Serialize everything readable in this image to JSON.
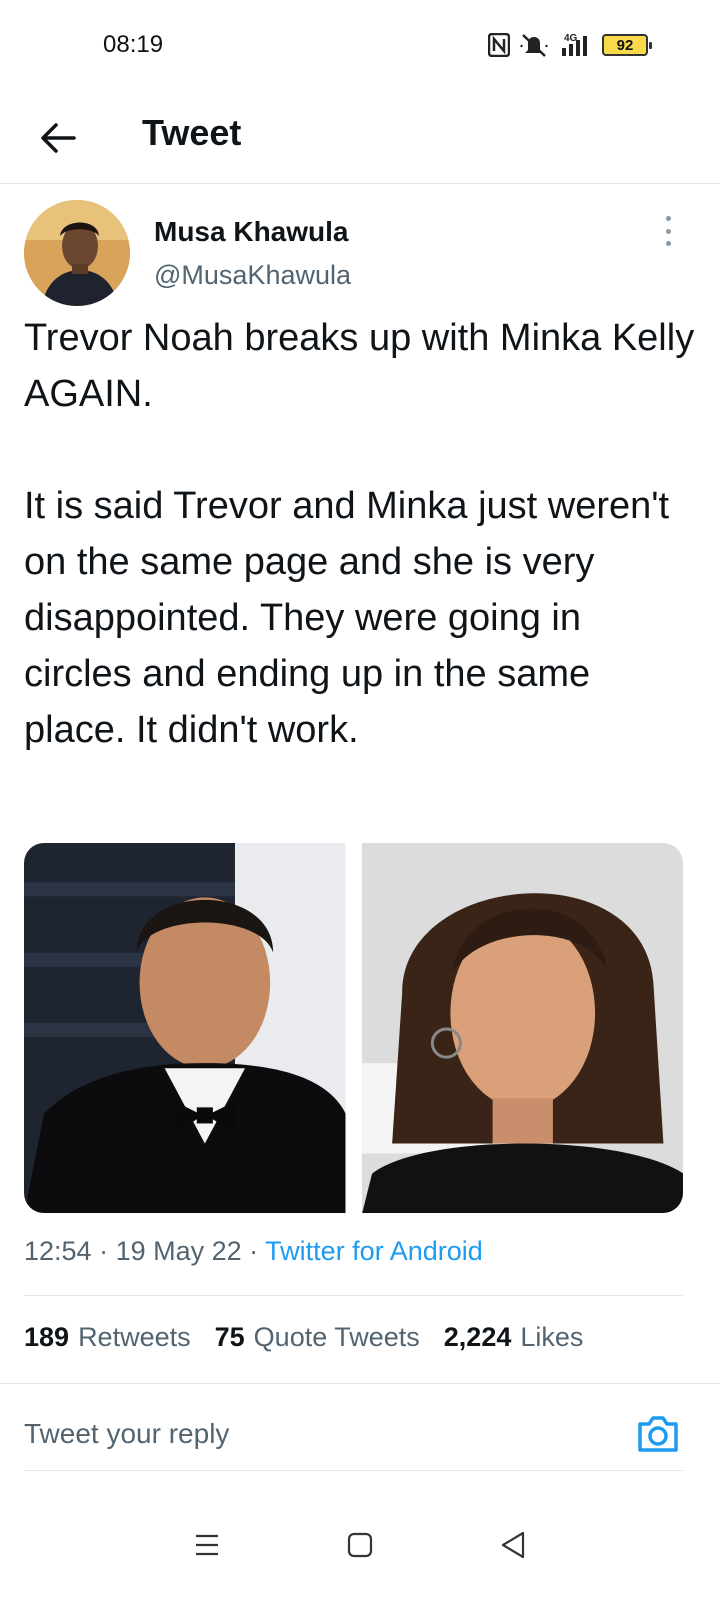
{
  "status_bar": {
    "time": "08:19",
    "network": "4G",
    "battery": "92"
  },
  "header": {
    "title": "Tweet"
  },
  "tweet": {
    "author_name": "Musa Khawula",
    "author_handle": "@MusaKhawula",
    "text": "Trevor Noah breaks up with Minka Kelly AGAIN.\n\nIt is said Trevor and Minka just weren't on the same page and she is very disappointed. They were going in circles and ending up in the same place. It didn't work.",
    "time": "12:54",
    "date": "19 May 22",
    "source": "Twitter for Android",
    "separator": " · "
  },
  "stats": {
    "retweets_count": "189",
    "retweets_label": "Retweets",
    "quotes_count": "75",
    "quotes_label": "Quote Tweets",
    "likes_count": "2,224",
    "likes_label": "Likes"
  },
  "reply": {
    "placeholder": "Tweet your reply"
  },
  "colors": {
    "accent": "#1d9bf0",
    "text": "#0f1419",
    "secondary": "#536471"
  },
  "icons": {
    "back": "arrow-left-icon",
    "more": "more-vertical-icon",
    "camera": "camera-icon",
    "nav_menu": "menu-icon",
    "nav_home": "square-icon",
    "nav_back": "triangle-back-icon"
  }
}
